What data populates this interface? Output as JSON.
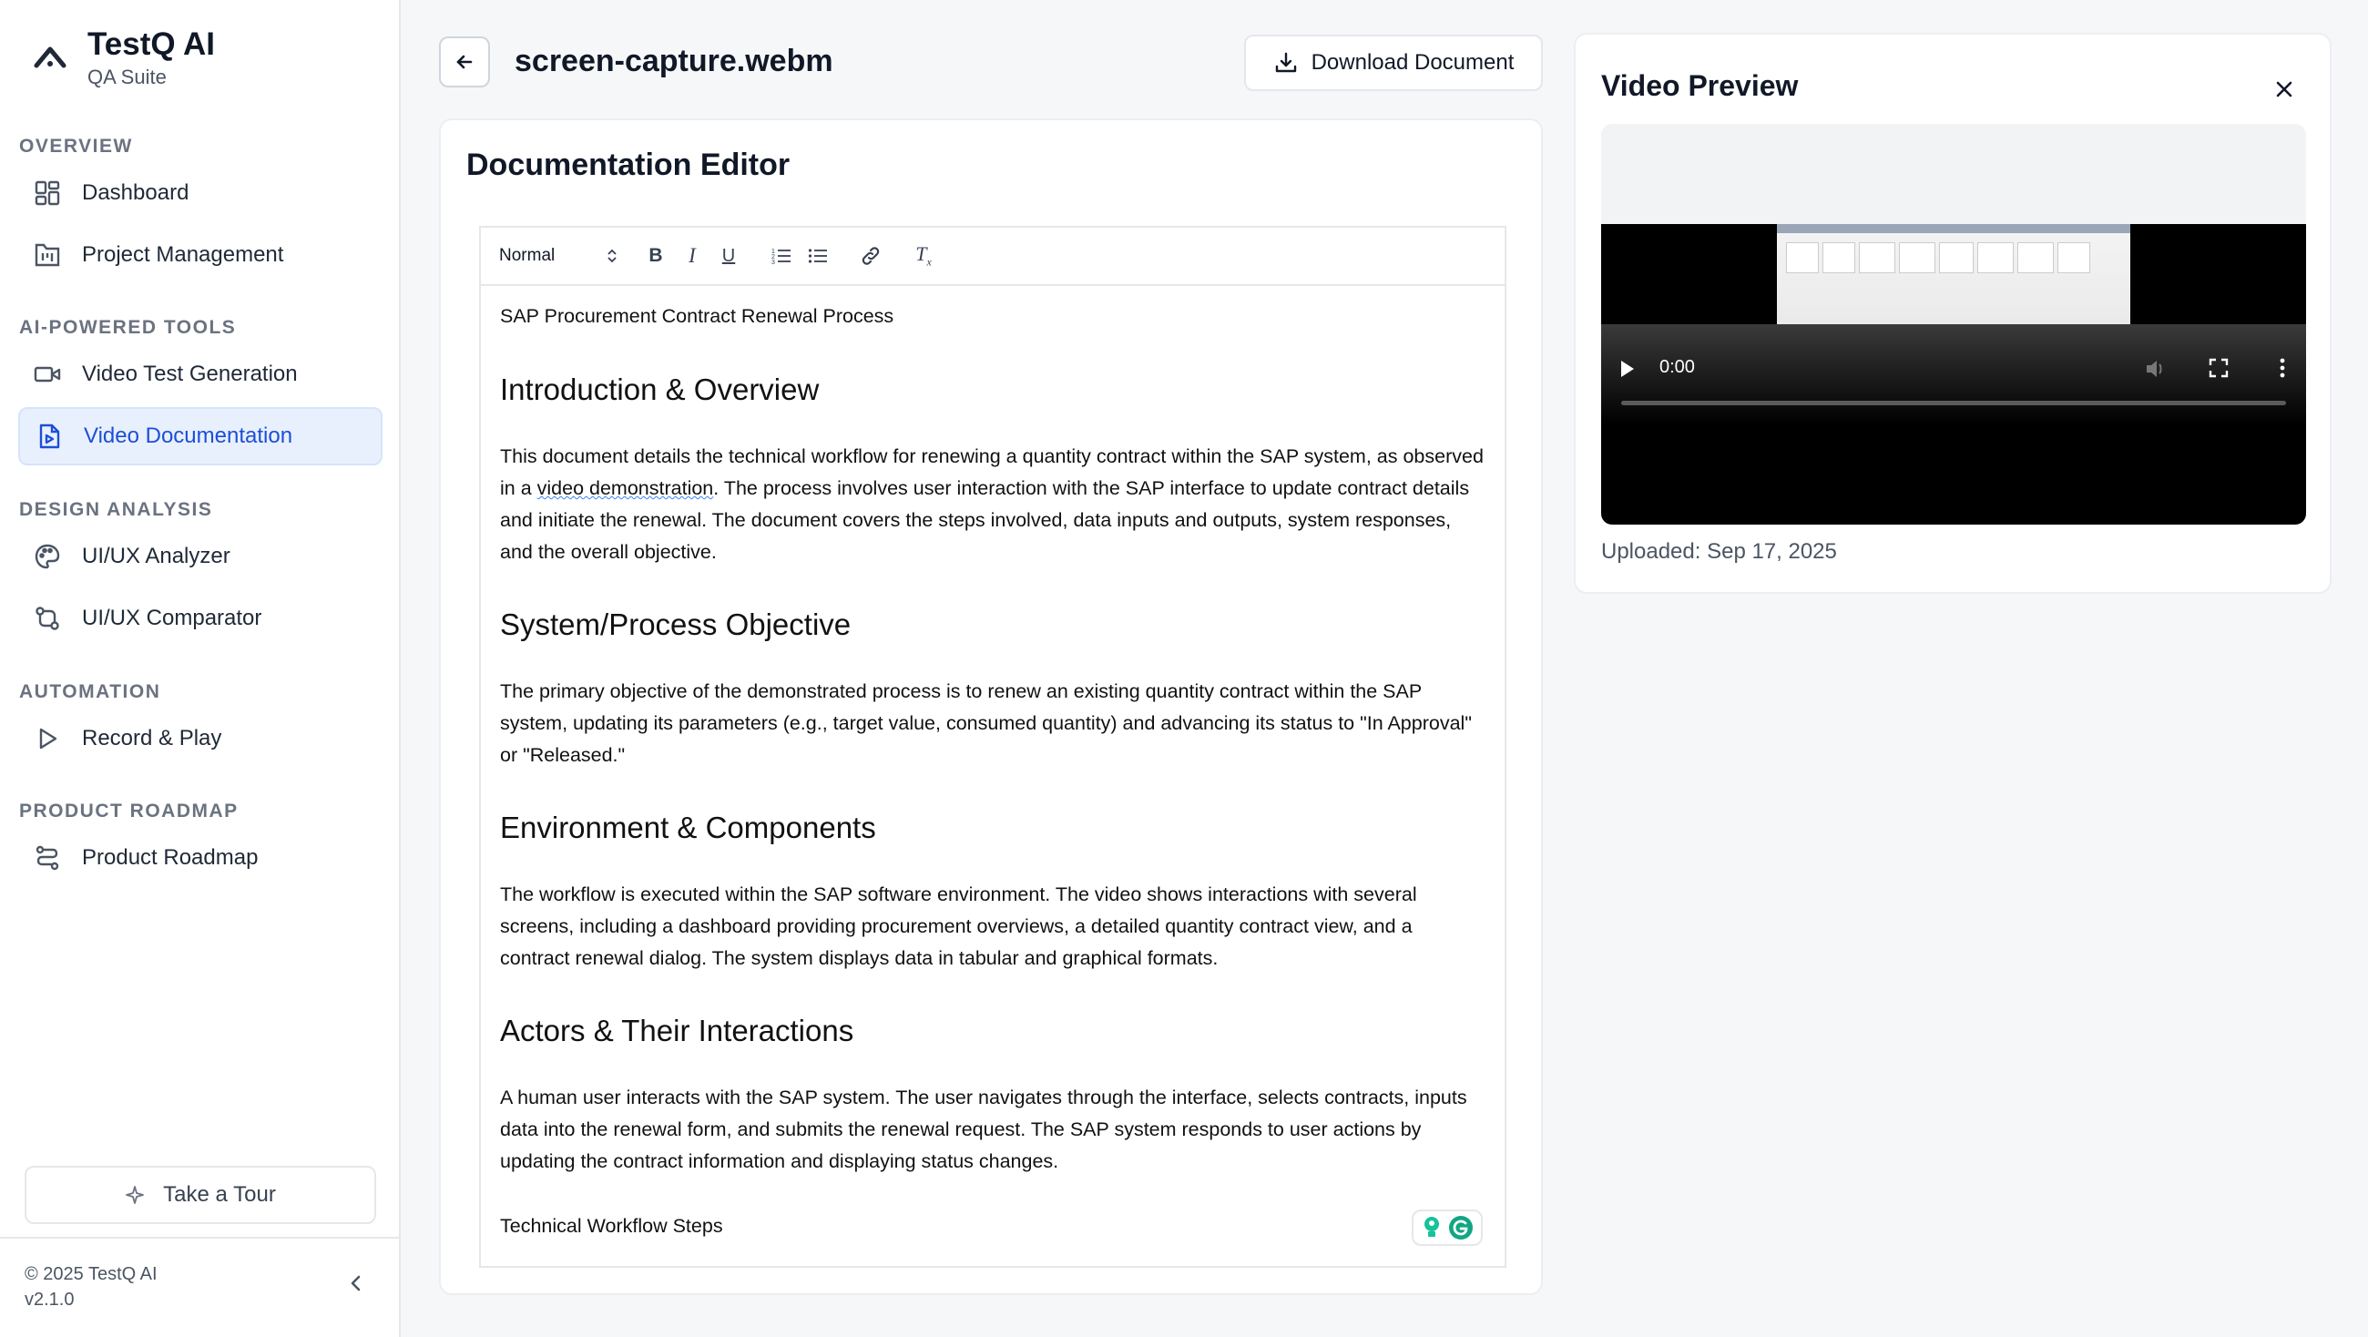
{
  "brand": {
    "title": "TestQ AI",
    "subtitle": "QA Suite"
  },
  "nav": {
    "overview": {
      "heading": "OVERVIEW",
      "items": [
        {
          "label": "Dashboard",
          "icon": "dashboard-icon"
        },
        {
          "label": "Project Management",
          "icon": "kanban-icon"
        }
      ]
    },
    "ai_tools": {
      "heading": "AI-POWERED TOOLS",
      "items": [
        {
          "label": "Video Test Generation",
          "icon": "video-icon"
        },
        {
          "label": "Video Documentation",
          "icon": "file-video-icon",
          "active": true
        }
      ]
    },
    "design": {
      "heading": "DESIGN ANALYSIS",
      "items": [
        {
          "label": "UI/UX Analyzer",
          "icon": "palette-icon"
        },
        {
          "label": "UI/UX Comparator",
          "icon": "git-compare-icon"
        }
      ]
    },
    "automation": {
      "heading": "AUTOMATION",
      "items": [
        {
          "label": "Record & Play",
          "icon": "play-icon"
        }
      ]
    },
    "roadmap": {
      "heading": "PRODUCT ROADMAP",
      "items": [
        {
          "label": "Product Roadmap",
          "icon": "route-icon"
        }
      ]
    }
  },
  "tour": {
    "label": "Take a Tour"
  },
  "footer": {
    "copyright": "© 2025 TestQ AI",
    "version": "v2.1.0"
  },
  "header": {
    "file_name": "screen-capture.webm",
    "download_label": "Download Document"
  },
  "editor": {
    "title": "Documentation Editor",
    "format_select": "Normal",
    "doc": {
      "first_line": "SAP Procurement Contract Renewal Process",
      "h1": "Introduction & Overview",
      "p1_a": "This document details the technical workflow for renewing a quantity contract within the SAP system, as observed in a ",
      "p1_u": "video demonstration",
      "p1_b": ". The process involves user interaction with the SAP interface to update contract details and initiate the renewal. The document covers the steps involved, data inputs and outputs, system responses, and the overall objective.",
      "h2": "System/Process Objective",
      "p2": "The primary objective of the demonstrated process is to renew an existing quantity contract within the SAP system, updating its parameters (e.g., target value, consumed quantity) and advancing its status to \"In Approval\" or \"Released.\"",
      "h3": "Environment & Components",
      "p3": "The workflow is executed within the SAP software environment. The video shows interactions with several screens, including a dashboard providing procurement overviews, a detailed quantity contract view, and a contract renewal dialog. The system displays data in tabular and graphical formats.",
      "h4": "Actors & Their Interactions",
      "p4": "A human user interacts with the SAP system. The user navigates through the interface, selects contracts, inputs data into the renewal form, and submits the renewal request. The SAP system responds to user actions by updating the contract information and displaying status changes.",
      "p5": "Technical Workflow Steps"
    }
  },
  "preview": {
    "title": "Video Preview",
    "time": "0:00",
    "uploaded": "Uploaded: Sep 17, 2025"
  },
  "colors": {
    "accent": "#1d4ed8",
    "active_bg": "#e8f0fd",
    "grammarly": "#15c39a"
  }
}
